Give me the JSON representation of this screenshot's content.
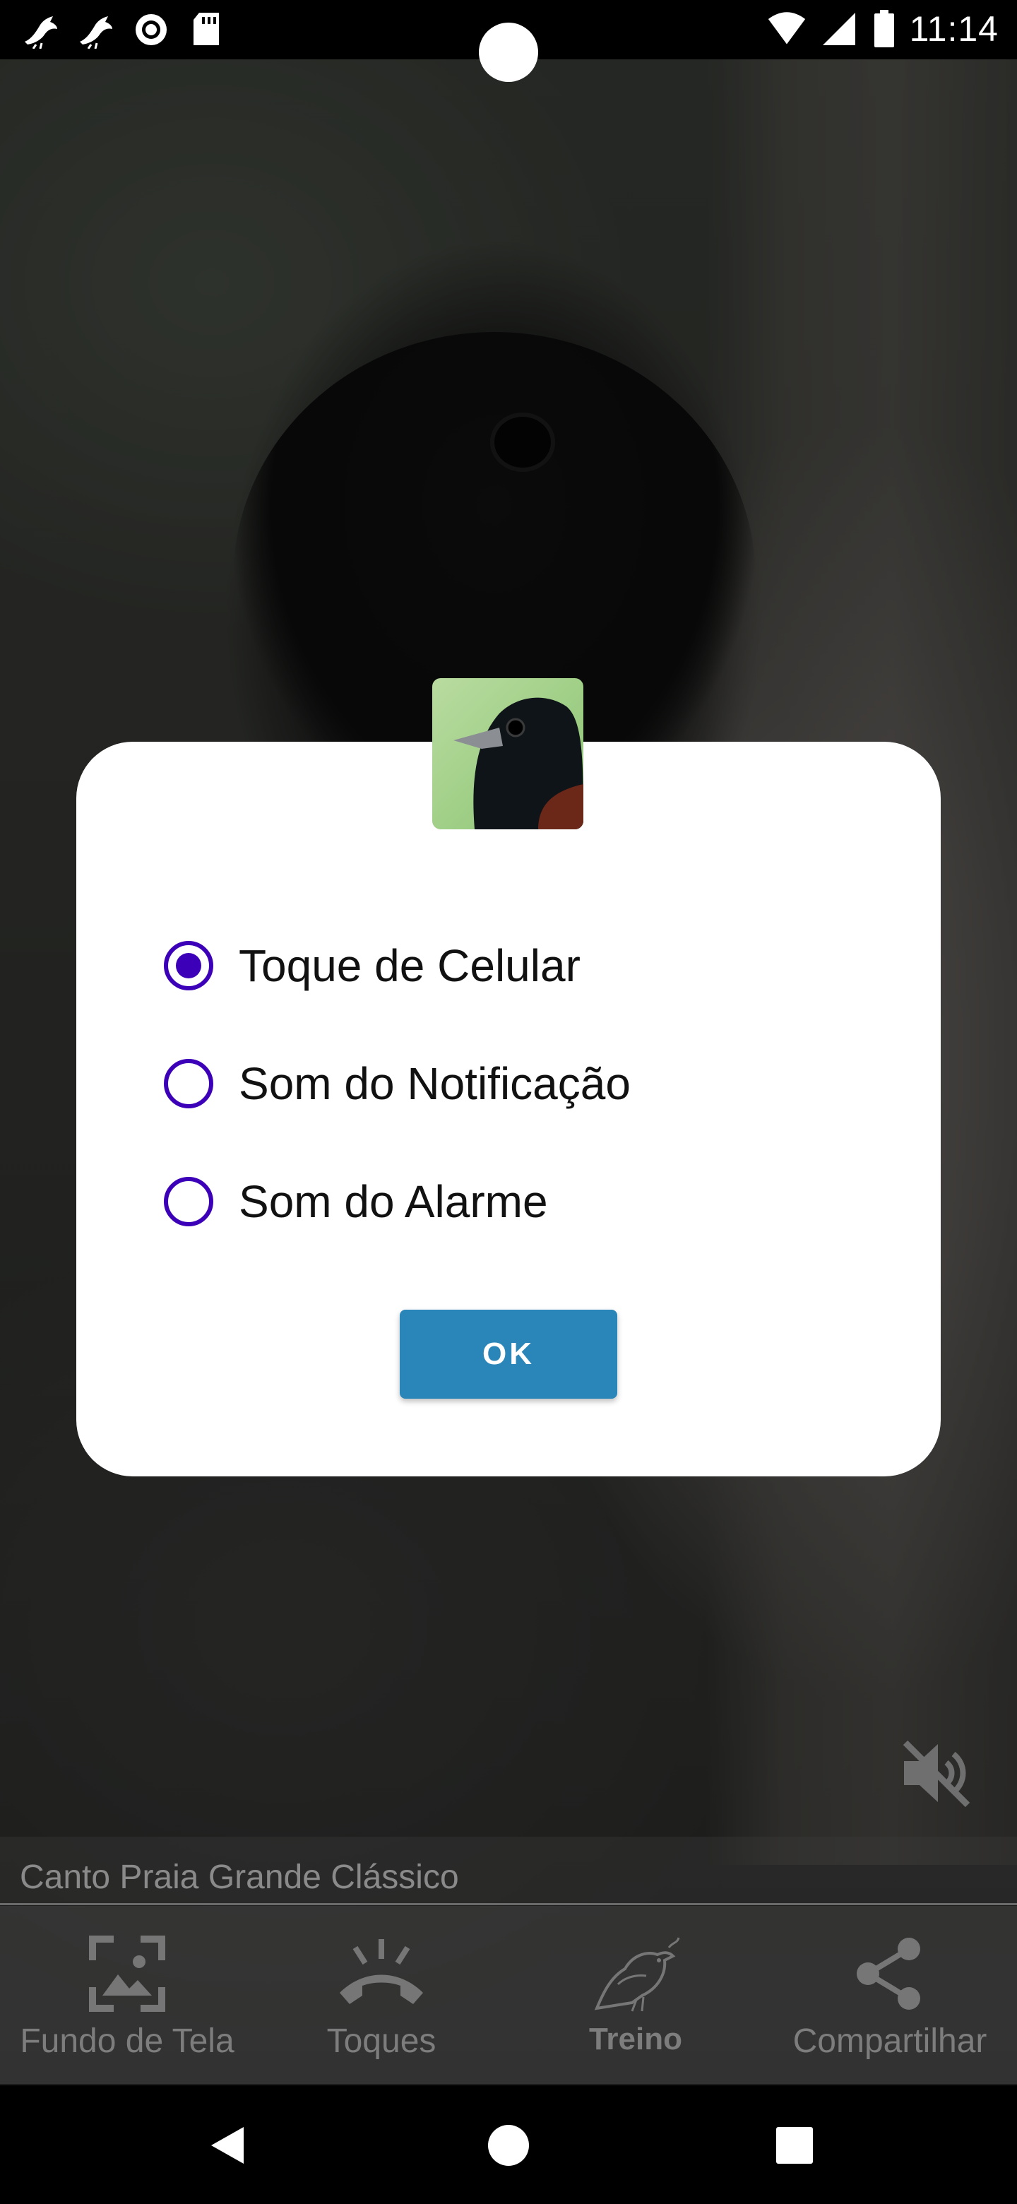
{
  "status_bar": {
    "time": "11:14",
    "left_icons": [
      "bird-notification-icon",
      "bird-notification-icon",
      "record-icon",
      "sd-card-icon"
    ],
    "right_icons": [
      "wifi-icon",
      "cellular-signal-icon",
      "battery-icon"
    ]
  },
  "dialog": {
    "options": [
      {
        "label": "Toque de Celular",
        "checked": true
      },
      {
        "label": "Som do Notificação",
        "checked": false
      },
      {
        "label": "Som do Alarme",
        "checked": false
      }
    ],
    "ok_label": "OK",
    "accent_color": "#3b00b7",
    "button_color": "#2a86b9"
  },
  "player": {
    "song_title": "Canto Praia Grande Clássico",
    "mute_icon": "volume-off-icon"
  },
  "bottom_nav": {
    "items": [
      {
        "label": "Fundo de Tela",
        "icon": "wallpaper-icon"
      },
      {
        "label": "Toques",
        "icon": "ring-volume-icon"
      },
      {
        "label": "Treino",
        "icon": "bird-icon"
      },
      {
        "label": "Compartilhar",
        "icon": "share-icon"
      }
    ]
  },
  "system_nav": {
    "buttons": [
      "back-icon",
      "home-icon",
      "recents-icon"
    ]
  }
}
